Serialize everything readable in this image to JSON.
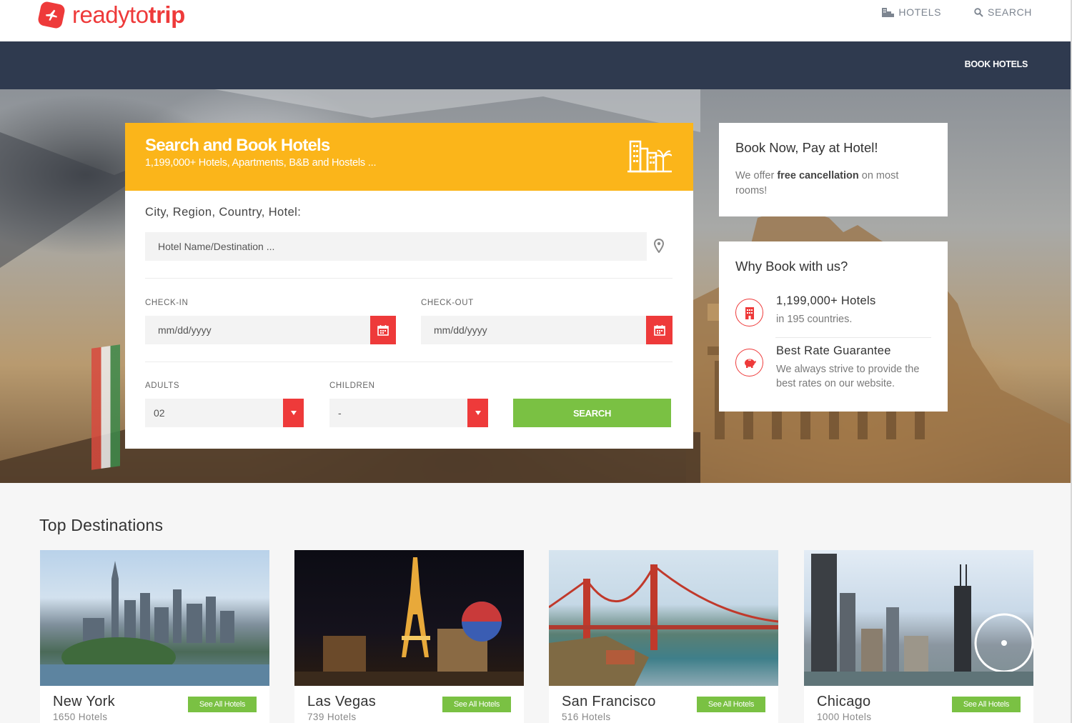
{
  "header": {
    "logo": {
      "part1": "readyto",
      "part2": "trip"
    },
    "nav": [
      {
        "label": "HOTELS",
        "icon": "hotel-icon"
      },
      {
        "label": "SEARCH",
        "icon": "search-icon"
      }
    ],
    "book_hotels": "BOOK HOTELS"
  },
  "search": {
    "title": "Search and Book Hotels",
    "subtitle": "1,199,000+ Hotels, Apartments, B&B and Hostels ...",
    "destination_label": "City, Region, Country, Hotel:",
    "destination_placeholder": "Hotel Name/Destination ...",
    "checkin_label": "CHECK-IN",
    "checkin_placeholder": "mm/dd/yyyy",
    "checkout_label": "CHECK-OUT",
    "checkout_placeholder": "mm/dd/yyyy",
    "adults_label": "ADULTS",
    "adults_value": "02",
    "children_label": "CHILDREN",
    "children_value": "-",
    "search_button": "SEARCH"
  },
  "book_now": {
    "title": "Book Now, Pay at Hotel!",
    "text_before": "We offer ",
    "text_bold": "free cancellation",
    "text_after": " on most rooms!"
  },
  "why_book": {
    "title": "Why Book with us?",
    "features": [
      {
        "title": "1,199,000+ Hotels",
        "desc": "in 195 countries."
      },
      {
        "title": "Best Rate Guarantee",
        "desc": "We always strive to provide the best rates on our website."
      }
    ]
  },
  "destinations": {
    "title": "Top Destinations",
    "button_label": "See All Hotels",
    "items": [
      {
        "name": "New York",
        "count": "1650 Hotels"
      },
      {
        "name": "Las Vegas",
        "count": "739 Hotels"
      },
      {
        "name": "San Francisco",
        "count": "516 Hotels"
      },
      {
        "name": "Chicago",
        "count": "1000 Hotels"
      }
    ]
  },
  "colors": {
    "brand_red": "#ee3a3a",
    "accent_yellow": "#fbb51a",
    "action_green": "#7ac143",
    "navbar": "#2f3a4f"
  }
}
